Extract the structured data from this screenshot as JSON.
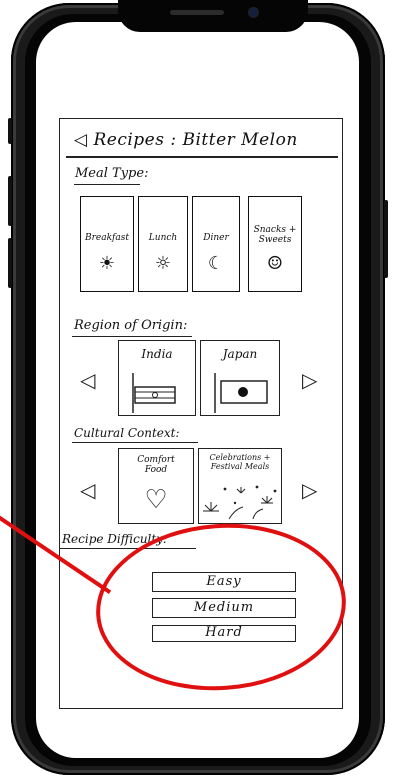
{
  "screen": {
    "title": "◁ Recipes : Bitter Melon"
  },
  "meal_type": {
    "heading": "Meal Type:",
    "items": [
      {
        "label": "Breakfast",
        "icon": "sunrise-icon",
        "glyph": "☀"
      },
      {
        "label": "Lunch",
        "icon": "sun-icon",
        "glyph": "☼"
      },
      {
        "label": "Diner",
        "icon": "moon-icon",
        "glyph": "☾"
      },
      {
        "label": "Snacks + Sweets",
        "icon": "smiley-icon",
        "glyph": "☺"
      }
    ]
  },
  "region": {
    "heading": "Region of Origin:",
    "items": [
      {
        "label": "India",
        "icon": "india-flag-icon"
      },
      {
        "label": "Japan",
        "icon": "japan-flag-icon"
      }
    ],
    "prev_glyph": "◁",
    "next_glyph": "▷"
  },
  "cultural": {
    "heading": "Cultural Context:",
    "items": [
      {
        "label": "Comfort Food",
        "icon": "heart-icon",
        "glyph": "♡"
      },
      {
        "label": "Celebrations + Festival Meals",
        "icon": "fireworks-icon"
      }
    ],
    "prev_glyph": "◁",
    "next_glyph": "▷"
  },
  "difficulty": {
    "heading": "Recipe Difficulty:",
    "options": [
      "Easy",
      "Medium",
      "Hard"
    ]
  },
  "colors": {
    "highlight": "#e01010",
    "ink": "#222222"
  }
}
